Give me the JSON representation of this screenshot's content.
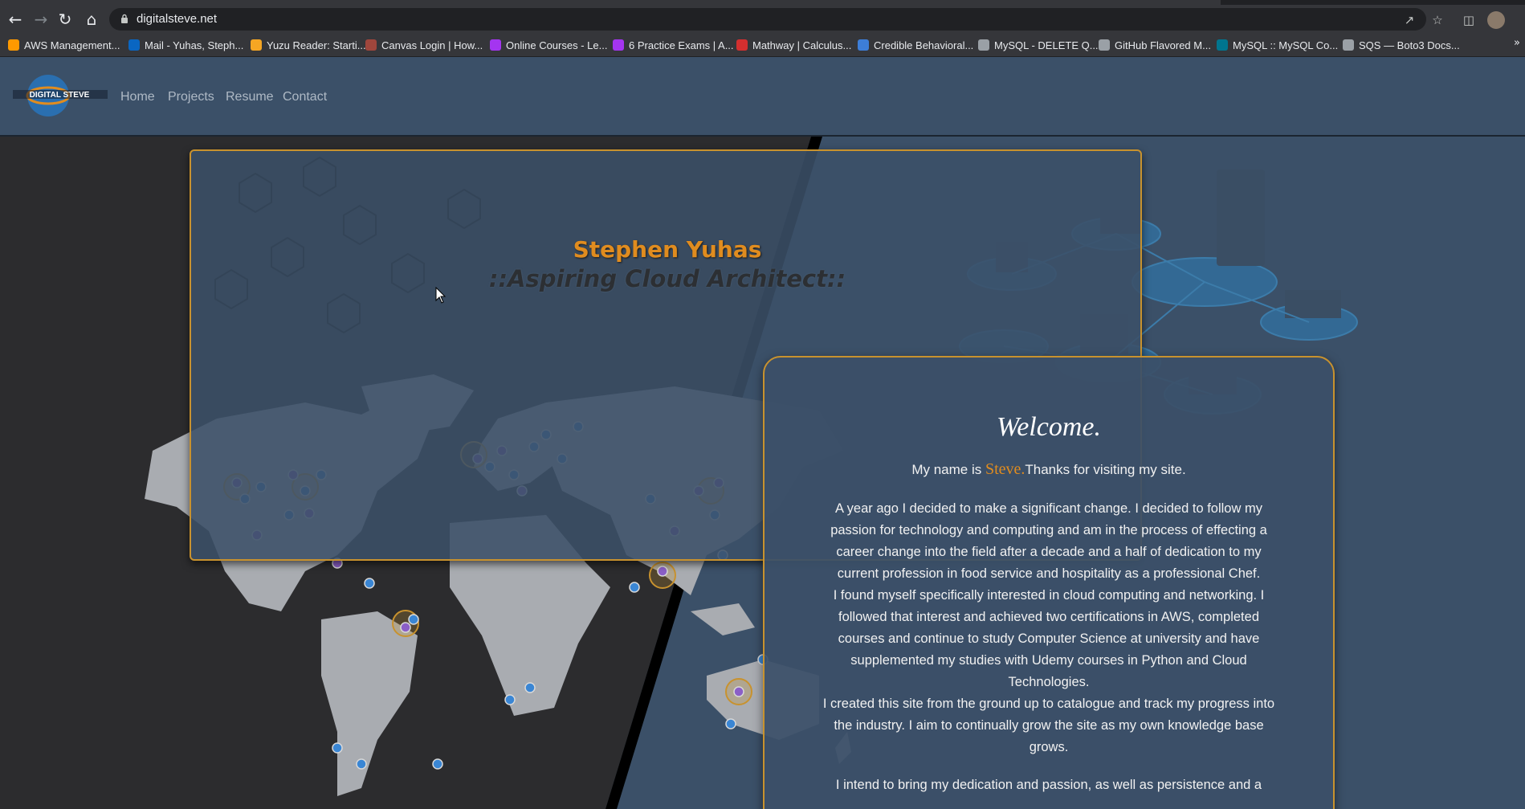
{
  "browser": {
    "url": "digitalsteve.net",
    "bookmarks": [
      {
        "label": "AWS Management...",
        "color": "#ff9900"
      },
      {
        "label": "Mail - Yuhas, Steph...",
        "color": "#0a66c2"
      },
      {
        "label": "Yuzu Reader: Starti...",
        "color": "#f5a623"
      },
      {
        "label": "Canvas Login | How...",
        "color": "#a0463c"
      },
      {
        "label": "Online Courses - Le...",
        "color": "#a435f0"
      },
      {
        "label": "6 Practice Exams | A...",
        "color": "#a435f0"
      },
      {
        "label": "Mathway | Calculus...",
        "color": "#d32f2f"
      },
      {
        "label": "Credible Behavioral...",
        "color": "#3d7ed8"
      },
      {
        "label": "MySQL - DELETE Q...",
        "color": "#9aa0a6"
      },
      {
        "label": "GitHub Flavored M...",
        "color": "#9aa0a6"
      },
      {
        "label": "MySQL :: MySQL Co...",
        "color": "#00758f"
      },
      {
        "label": "SQS — Boto3 Docs...",
        "color": "#9aa0a6"
      }
    ],
    "more": "»"
  },
  "site": {
    "nav": [
      "Home",
      "Projects",
      "Resume",
      "Contact"
    ],
    "logo_text": "DIGITAL STEVE",
    "hero": {
      "name": "Stephen Yuhas",
      "subtitle": "::Aspiring Cloud Architect::"
    },
    "welcome": {
      "title": "Welcome.",
      "intro_before": "My name is ",
      "intro_name": "Steve.",
      "intro_after": "Thanks for visiting my site.",
      "paragraphs": [
        "A year ago I decided to make a significant change. I decided to follow my passion for technology and computing and am in the process of effecting a career change into the field after a decade and a half of dedication to my current profession in food service and hospitality as a professional Chef.",
        "I found myself specifically interested in cloud computing and networking. I followed that interest and achieved two certifications in AWS, completed courses and continue to study Computer Science at university and have supplemented my studies with Udemy courses in Python and Cloud Technologies.",
        "I created this site from the ground up to catalogue and track my progress into the industry. I aim to continually grow the site as my own knowledge base grows.",
        "I intend to bring my dedication and passion, as well as persistence and a"
      ]
    }
  },
  "colors": {
    "header_bg": "#3b5068",
    "accent_orange": "#e08c1f",
    "card_border": "#c8922e",
    "map_land": "#a9acb1",
    "map_dot_blue": "#3a86d4",
    "map_dot_purple": "#8b5fc7"
  }
}
